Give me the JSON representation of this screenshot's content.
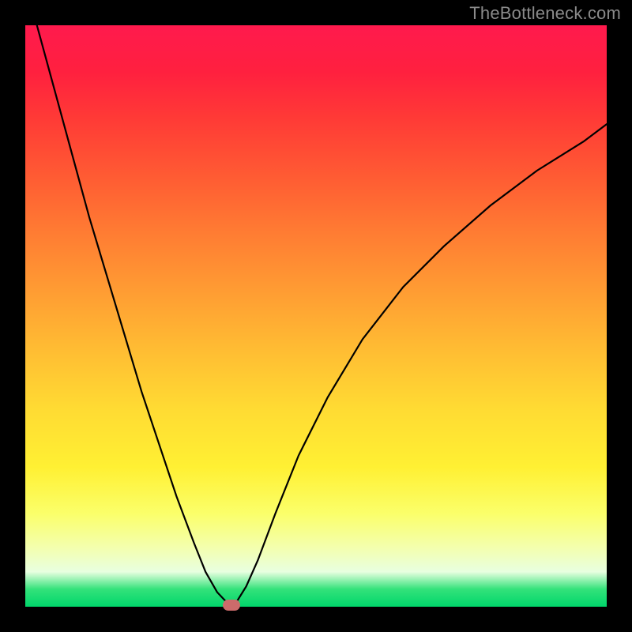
{
  "watermark": "TheBottleneck.com",
  "chart_data": {
    "type": "line",
    "title": "",
    "xlabel": "",
    "ylabel": "",
    "xlim": [
      0,
      100
    ],
    "ylim": [
      0,
      100
    ],
    "grid": false,
    "legend": false,
    "series": [
      {
        "name": "bottleneck-curve",
        "x": [
          2,
          5,
          8,
          11,
          14,
          17,
          20,
          23,
          26,
          29,
          31,
          33,
          34.8,
          35.5,
          36.2,
          38,
          40,
          43,
          47,
          52,
          58,
          65,
          72,
          80,
          88,
          96,
          100
        ],
        "values": [
          100,
          89,
          78,
          67,
          57,
          47,
          37,
          28,
          19,
          11,
          6,
          2.5,
          0.6,
          0,
          0.6,
          3.5,
          8,
          16,
          26,
          36,
          46,
          55,
          62,
          69,
          75,
          80,
          83
        ]
      }
    ],
    "marker": {
      "x": 35.5,
      "y": 0
    },
    "background_gradient": {
      "top": "#ff1a4d",
      "mid": "#fff033",
      "bottom": "#00d66b"
    }
  },
  "colors": {
    "curve": "#000000",
    "marker": "#cc6b6b",
    "frame": "#000000"
  }
}
